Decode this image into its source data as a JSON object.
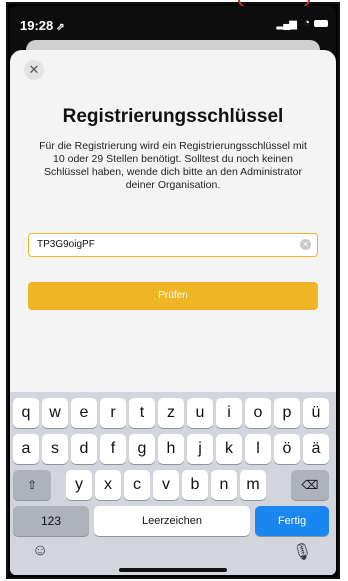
{
  "status_bar": {
    "time": "19:28",
    "location_glyph": "⇗"
  },
  "dialog": {
    "close_label": "✕",
    "title": "Registrierungsschlüssel",
    "description": "Für die Registrierung wird ein Registrierungsschlüssel mit 10 oder 29 Stellen benötigt. Solltest du noch keinen Schlüssel haben, wende dich bitte an den Administrator deiner Organisation.",
    "input_value": "TP3G9oigPF",
    "clear_label": "✕",
    "button_label": "Prüfen",
    "accent_color": "#f0b525"
  },
  "keyboard": {
    "row1": [
      "q",
      "w",
      "e",
      "r",
      "t",
      "z",
      "u",
      "i",
      "o",
      "p",
      "ü"
    ],
    "row2": [
      "a",
      "s",
      "d",
      "f",
      "g",
      "h",
      "j",
      "k",
      "l",
      "ö",
      "ä"
    ],
    "row3": [
      "y",
      "x",
      "c",
      "v",
      "b",
      "n",
      "m"
    ],
    "shift_label": "⇧",
    "backspace_label": "⌫",
    "numbers_label": "123",
    "space_label": "Leerzeichen",
    "return_label": "Fertig",
    "emoji_label": "☺",
    "mic_label": "🎙"
  }
}
